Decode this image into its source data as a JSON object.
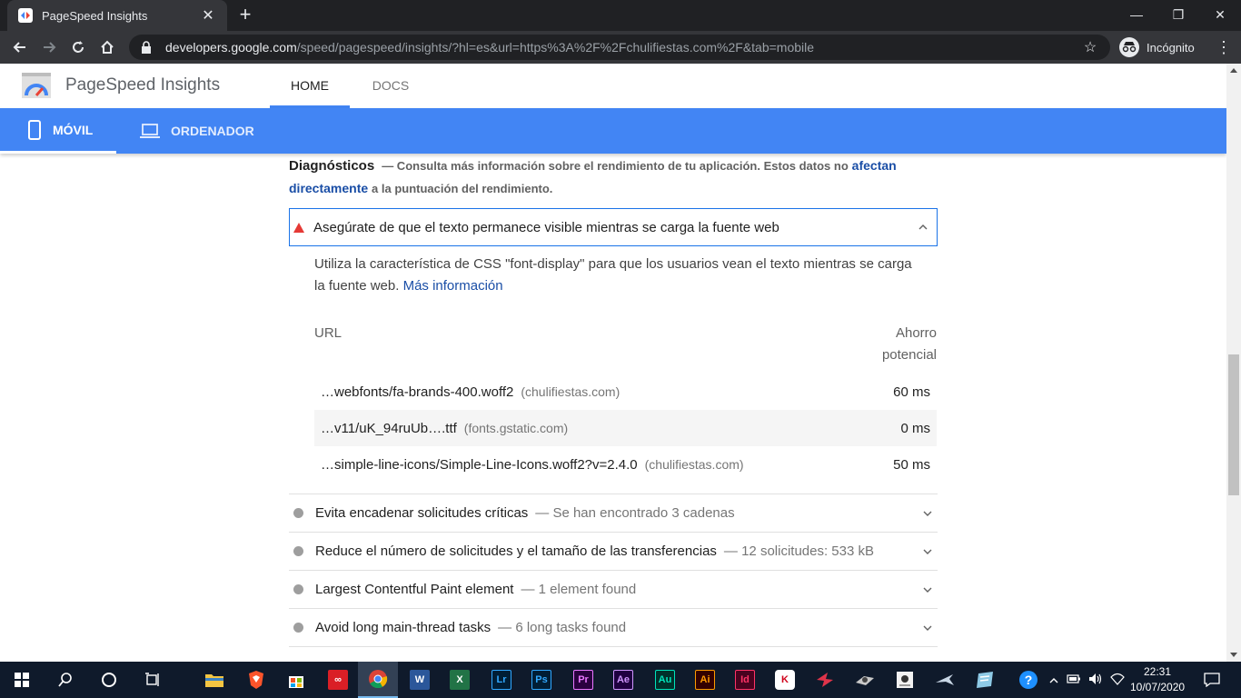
{
  "browser": {
    "tab_title": "PageSpeed Insights",
    "url_host": "developers.google.com",
    "url_path": "/speed/pagespeed/insights/?hl=es&url=https%3A%2F%2Fchulifiestas.com%2F&tab=mobile",
    "profile_label": "Incógnito"
  },
  "header": {
    "app_name": "PageSpeed Insights",
    "tabs": [
      {
        "label": "HOME"
      },
      {
        "label": "DOCS"
      }
    ]
  },
  "device_bar": {
    "mobile_label": "MÓVIL",
    "desktop_label": "ORDENADOR"
  },
  "diagnostics": {
    "title": "Diagnósticos",
    "intro": "— Consulta más información sobre el rendimiento de tu aplicación. Estos datos no",
    "link": "afectan directamente",
    "outro": "a la puntuación del rendimiento."
  },
  "open_audit": {
    "title": "Asegúrate de que el texto permanece visible mientras se carga la fuente web",
    "description": "Utiliza la característica de CSS \"font-display\" para que los usuarios vean el texto mientras se carga la fuente web.",
    "learn_more": "Más información",
    "col_url": "URL",
    "col_savings_1": "Ahorro",
    "col_savings_2": "potencial",
    "rows": [
      {
        "url": "…webfonts/fa-brands-400.woff2",
        "host": "(chulifiestas.com)",
        "value": "60 ms"
      },
      {
        "url": "…v11/uK_94ruUb….ttf",
        "host": "(fonts.gstatic.com)",
        "value": "0 ms"
      },
      {
        "url": "…simple-line-icons/Simple-Line-Icons.woff2?v=2.4.0",
        "host": "(chulifiestas.com)",
        "value": "50 ms"
      }
    ]
  },
  "audits": [
    {
      "title": "Evita encadenar solicitudes críticas",
      "summary": "— Se han encontrado 3 cadenas"
    },
    {
      "title": "Reduce el número de solicitudes y el tamaño de las transferencias",
      "summary": "— 12 solicitudes: 533 kB"
    },
    {
      "title": "Largest Contentful Paint element",
      "summary": "— 1 element found"
    },
    {
      "title": "Avoid long main-thread tasks",
      "summary": "— 6 long tasks found"
    }
  ],
  "taskbar": {
    "clock_time": "22:31",
    "clock_date": "10/07/2020",
    "apps": [
      "Lr",
      "Ps",
      "Pr",
      "Ae",
      "Au",
      "Ai",
      "Id"
    ]
  },
  "colors": {
    "accent": "#4285f4",
    "fail": "#e53935",
    "link": "#1a4ea6"
  }
}
